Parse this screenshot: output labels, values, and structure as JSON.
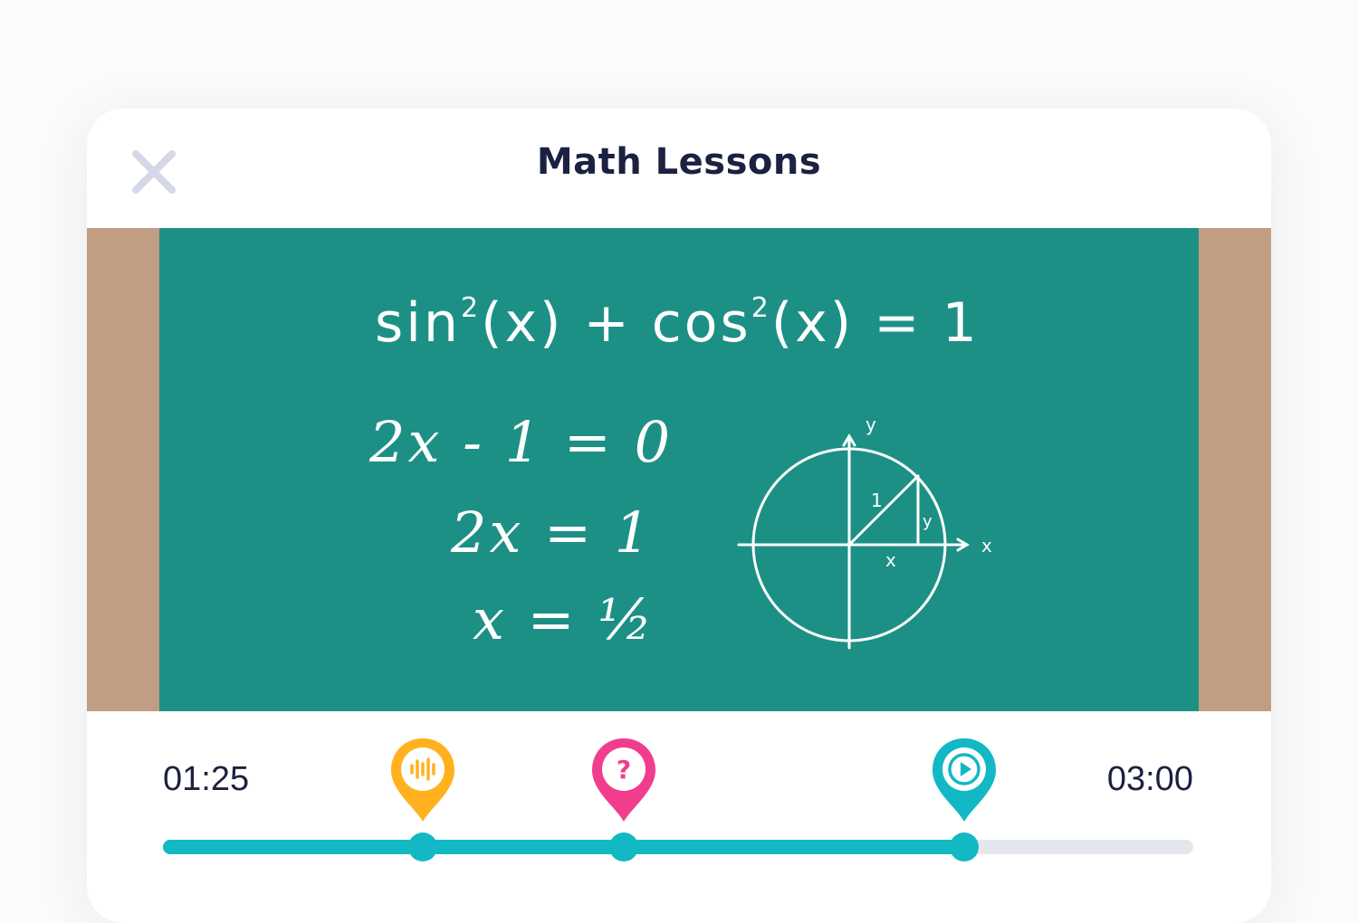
{
  "window": {
    "title": "Math Lessons",
    "close_icon": "close-icon"
  },
  "board": {
    "equation_top": {
      "main": "sin",
      "sq1": "2",
      "mid": "(x) + cos",
      "sq2": "2",
      "end": "(x) = 1"
    },
    "steps": [
      "2x - 1 = 0",
      "2x = 1",
      "x = ½"
    ],
    "unit_circle_labels": {
      "x_axis": "x",
      "y_axis": "y",
      "radius": "1",
      "adjacent": "x",
      "opposite": "y"
    }
  },
  "player": {
    "current_time": "01:25",
    "total_time": "03:00",
    "progress": 0.78,
    "colors": {
      "track": "#e4e7ee",
      "fill": "#12b8c4"
    },
    "markers": [
      {
        "type": "audio",
        "icon": "audio-wave-icon",
        "color": "#ffb11f",
        "position": 0.252
      },
      {
        "type": "question",
        "icon": "question-icon",
        "label": "?",
        "color": "#f23d8e",
        "position": 0.447
      },
      {
        "type": "video",
        "icon": "play-icon",
        "color": "#12b8c4",
        "position": 0.778
      }
    ]
  }
}
